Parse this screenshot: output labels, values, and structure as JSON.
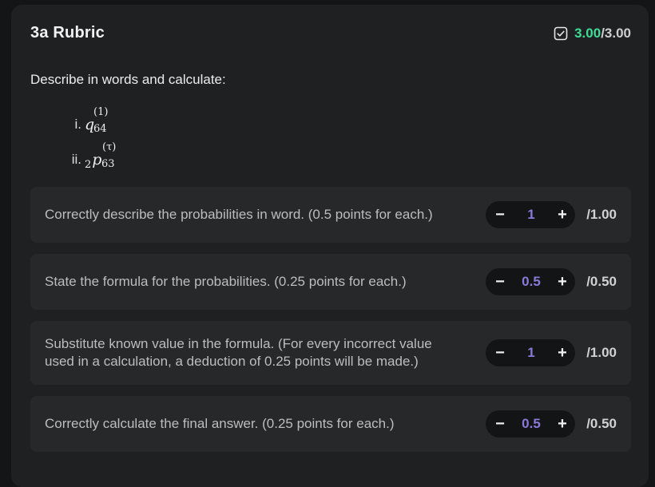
{
  "rubric": {
    "title": "3a Rubric",
    "score_earned": "3.00",
    "score_total": "/3.00",
    "score_icon": "checkbox-checked-icon",
    "earned_color": "#3ddc97"
  },
  "description": "Describe in words and calculate:",
  "sub_items": [
    {
      "roman": "i.",
      "symbol": "q",
      "superscript": "(1)",
      "subscript": "64",
      "presubscript": ""
    },
    {
      "roman": "ii.",
      "symbol": "p",
      "superscript": "(τ)",
      "subscript": "63",
      "presubscript": "2"
    }
  ],
  "criteria": [
    {
      "text": "Correctly describe the probabilities in word. (0.5 points for each.)",
      "value": "1",
      "max": "/1.00"
    },
    {
      "text": "State the formula for the probabilities. (0.25 points for each.)",
      "value": "0.5",
      "max": "/0.50"
    },
    {
      "text": "Substitute known value in the formula. (For every incorrect value used in a calculation, a deduction of 0.25 points will be made.)",
      "value": "1",
      "max": "/1.00"
    },
    {
      "text": "Correctly calculate the final answer. (0.25 points for each.)",
      "value": "0.5",
      "max": "/0.50"
    }
  ],
  "stepper": {
    "minus_label": "−",
    "plus_label": "+",
    "value_color": "#8b79d9"
  }
}
